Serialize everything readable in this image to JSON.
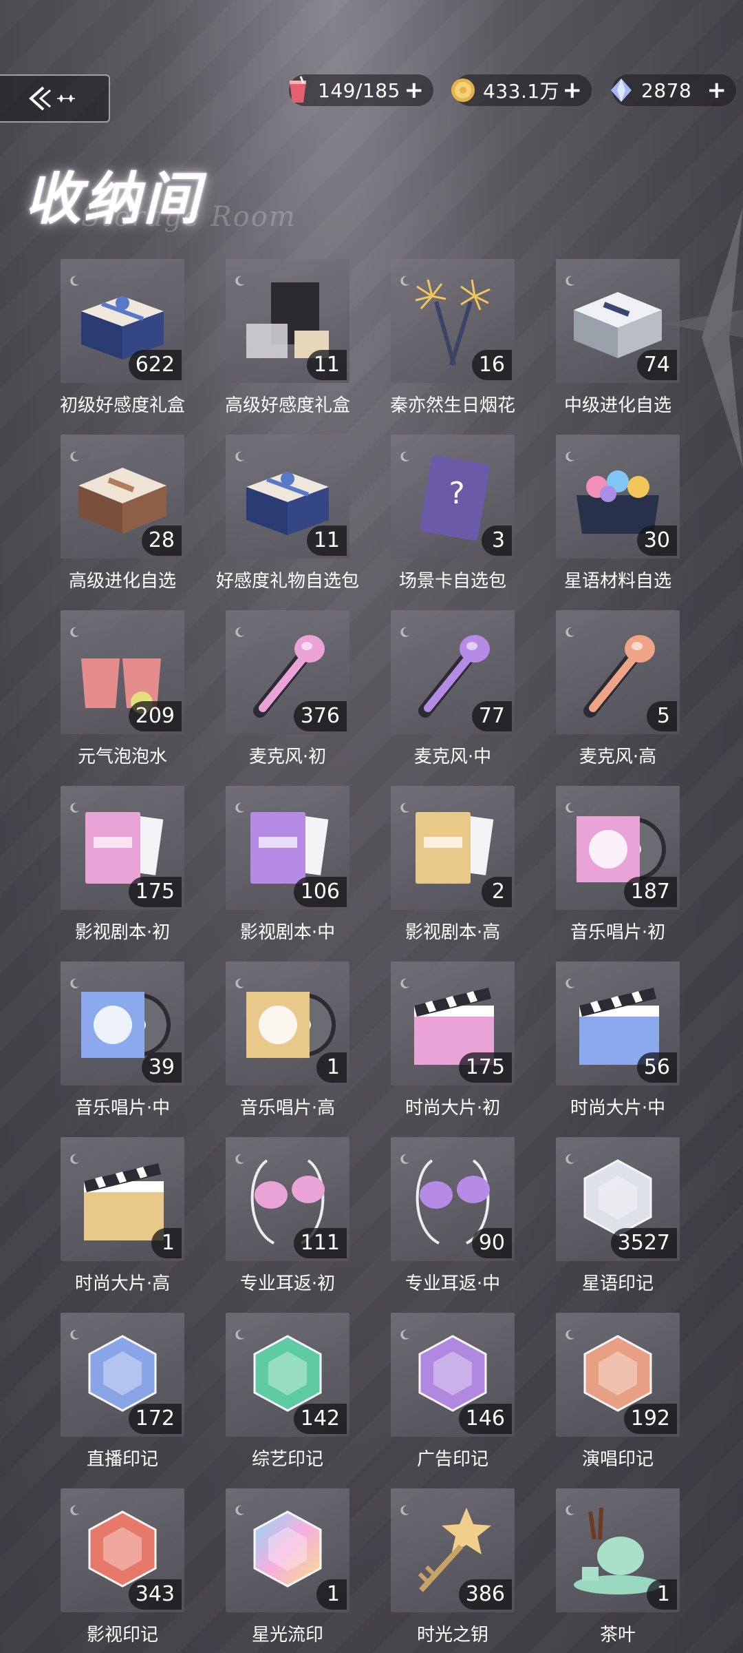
{
  "header": {
    "title": "收纳间",
    "subtitle": "Storage Room",
    "currencies": [
      {
        "icon": "drink-icon",
        "value": "149/185"
      },
      {
        "icon": "gold-coin-icon",
        "value": "433.1万"
      },
      {
        "icon": "diamond-icon",
        "value": "2878"
      }
    ],
    "plus": "+"
  },
  "items": [
    {
      "name": "初级好感度礼盒",
      "count": "622",
      "icon": "gift-box-blue-icon"
    },
    {
      "name": "高级好感度礼盒",
      "count": "11",
      "icon": "gift-set-icon"
    },
    {
      "name": "秦亦然生日烟花",
      "count": "16",
      "icon": "fireworks-icon"
    },
    {
      "name": "中级进化自选",
      "count": "74",
      "icon": "silver-box-icon"
    },
    {
      "name": "高级进化自选",
      "count": "28",
      "icon": "brown-box-icon"
    },
    {
      "name": "好感度礼物自选包",
      "count": "11",
      "icon": "gift-box-blue-icon"
    },
    {
      "name": "场景卡自选包",
      "count": "3",
      "icon": "scene-card-icon"
    },
    {
      "name": "星语材料自选",
      "count": "30",
      "icon": "gem-chest-icon"
    },
    {
      "name": "元气泡泡水",
      "count": "209",
      "icon": "bubble-drink-icon"
    },
    {
      "name": "麦克风·初",
      "count": "376",
      "icon": "microphone-pink-icon"
    },
    {
      "name": "麦克风·中",
      "count": "77",
      "icon": "microphone-purple-icon"
    },
    {
      "name": "麦克风·高",
      "count": "5",
      "icon": "microphone-orange-icon"
    },
    {
      "name": "影视剧本·初",
      "count": "175",
      "icon": "script-pink-icon"
    },
    {
      "name": "影视剧本·中",
      "count": "106",
      "icon": "script-purple-icon"
    },
    {
      "name": "影视剧本·高",
      "count": "2",
      "icon": "script-gold-icon"
    },
    {
      "name": "音乐唱片·初",
      "count": "187",
      "icon": "record-pink-icon"
    },
    {
      "name": "音乐唱片·中",
      "count": "39",
      "icon": "record-blue-icon"
    },
    {
      "name": "音乐唱片·高",
      "count": "1",
      "icon": "record-gold-icon"
    },
    {
      "name": "时尚大片·初",
      "count": "175",
      "icon": "clapper-pink-icon"
    },
    {
      "name": "时尚大片·中",
      "count": "56",
      "icon": "clapper-blue-icon"
    },
    {
      "name": "时尚大片·高",
      "count": "1",
      "icon": "clapper-gold-icon"
    },
    {
      "name": "专业耳返·初",
      "count": "111",
      "icon": "earphones-pink-icon"
    },
    {
      "name": "专业耳返·中",
      "count": "90",
      "icon": "earphones-purple-icon"
    },
    {
      "name": "星语印记",
      "count": "3527",
      "icon": "crystal-white-icon"
    },
    {
      "name": "直播印记",
      "count": "172",
      "icon": "crystal-blue-icon"
    },
    {
      "name": "综艺印记",
      "count": "142",
      "icon": "crystal-green-icon"
    },
    {
      "name": "广告印记",
      "count": "146",
      "icon": "crystal-purple-icon"
    },
    {
      "name": "演唱印记",
      "count": "192",
      "icon": "crystal-orange-icon"
    },
    {
      "name": "影视印记",
      "count": "343",
      "icon": "crystal-red-icon"
    },
    {
      "name": "星光流印",
      "count": "1",
      "icon": "crystal-rainbow-icon"
    },
    {
      "name": "时光之钥",
      "count": "386",
      "icon": "star-key-icon"
    },
    {
      "name": "茶叶",
      "count": "1",
      "icon": "tea-set-icon"
    }
  ],
  "colors": {
    "pink": "#e9a3d6",
    "purple": "#b58be6",
    "orange": "#f0a487",
    "blue": "#8ca9ee",
    "gold": "#e8c98a",
    "green": "#5fd1a6",
    "red": "#ee7b6b",
    "white": "#e6e9f2"
  }
}
